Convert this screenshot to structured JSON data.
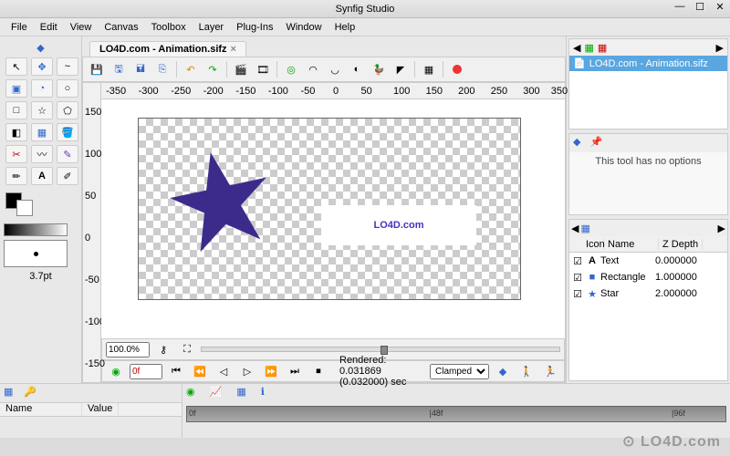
{
  "app_title": "Synfig Studio",
  "menu": [
    "File",
    "Edit",
    "View",
    "Canvas",
    "Toolbox",
    "Layer",
    "Plug-Ins",
    "Window",
    "Help"
  ],
  "document": {
    "tab_title": "LO4D.com - Animation.sifz",
    "zoom": "100.0%",
    "rendered_status": "Rendered: 0.031869 (0.032000) sec",
    "frame_field": "0f",
    "interp_mode": "Clamped"
  },
  "canvas": {
    "text_content": "LO4D.com",
    "star_color": "#3d2b8c",
    "ruler_h": [
      "-350",
      "-300",
      "-250",
      "-200",
      "-150",
      "-100",
      "-50",
      "0",
      "50",
      "100",
      "150",
      "200",
      "250",
      "300",
      "350"
    ],
    "ruler_v": [
      "150",
      "100",
      "50",
      "0",
      "-50",
      "-100",
      "-150"
    ]
  },
  "toolbox": {
    "stroke_size": "3.7pt",
    "tools": [
      "pointer",
      "move",
      "smooth",
      "scale",
      "rotate",
      "mirror",
      "circle",
      "rectangle",
      "star",
      "polygon",
      "gradient",
      "fill",
      "bline",
      "draw",
      "pencil",
      "eraser",
      "text",
      "eyedrop"
    ]
  },
  "right": {
    "canvases": [
      "LO4D.com - Animation.sifz"
    ],
    "no_options": "This tool has no options",
    "layer_columns": [
      "",
      "Icon",
      "Name",
      "Z Depth"
    ],
    "layers": [
      {
        "visible": true,
        "icon": "A",
        "name": "Text",
        "z": "0.000000"
      },
      {
        "visible": true,
        "icon": "■",
        "name": "Rectangle",
        "z": "1.000000"
      },
      {
        "visible": true,
        "icon": "★",
        "name": "Star",
        "z": "2.000000"
      }
    ]
  },
  "params": {
    "columns": [
      "Name",
      "Value"
    ]
  },
  "timeline": {
    "frames": [
      "0f",
      "|48f",
      "|96f"
    ]
  },
  "watermark": "⊙ LO4D.com"
}
